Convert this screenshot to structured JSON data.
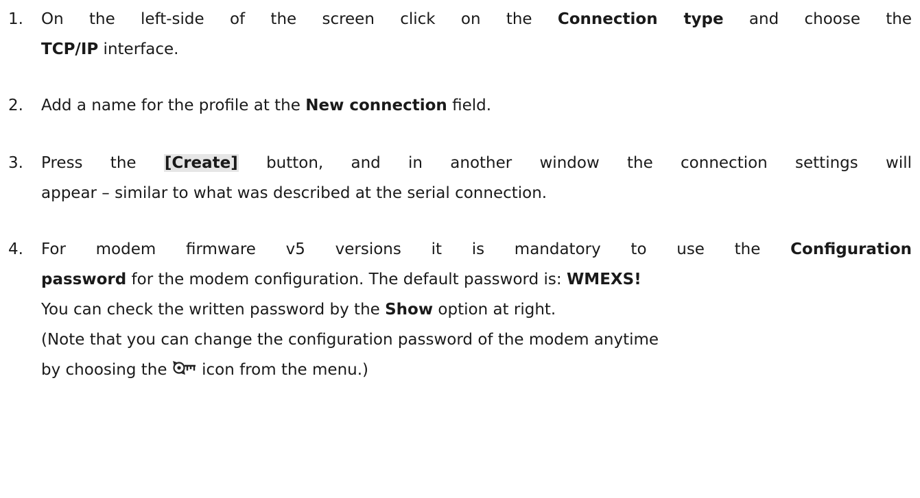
{
  "steps": [
    {
      "num": "1.",
      "t1": "On the left-side of the screen click on the ",
      "b1": "Connection type",
      "t2": " and choose the",
      "b2": "TCP/IP",
      "t3": " interface."
    },
    {
      "num": "2.",
      "t1": "Add a name for the profile at the ",
      "b1": "New connection",
      "t2": " field."
    },
    {
      "num": "3.",
      "t1": "Press the ",
      "button": "[Create]",
      "t2": " button, and in another window the connection settings will",
      "t3": "appear – similar to what was described at the serial connection."
    },
    {
      "num": "4.",
      "t1": "For modem firmware v5 versions it is mandatory to use the ",
      "b1": "Configuration",
      "b2": "password",
      "t2": " for the modem configuration. The default password is: ",
      "b3": "WMEXS!",
      "t3": "You can check the written password by the ",
      "b4": "Show",
      "t4": " option at right.",
      "t5": "(Note that you can change the configuration password of the modem anytime",
      "t6": "by choosing the ",
      "icon": "password-key-refresh-icon",
      "t7": " icon from the menu.)"
    }
  ]
}
